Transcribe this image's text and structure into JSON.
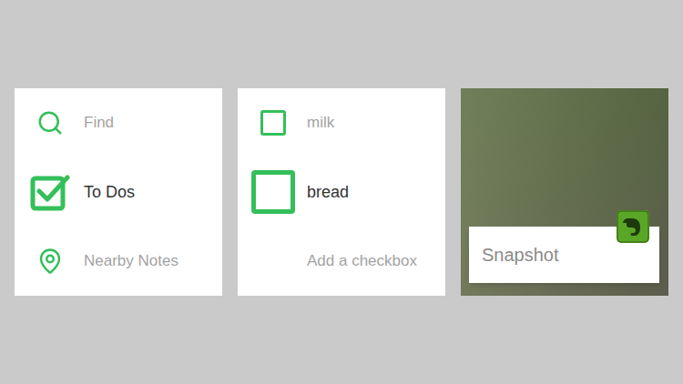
{
  "menu": {
    "items": [
      {
        "label": "Find",
        "kind": "search",
        "selected": false
      },
      {
        "label": "To Dos",
        "kind": "todo",
        "selected": true
      },
      {
        "label": "Nearby Notes",
        "kind": "pin",
        "selected": false
      }
    ]
  },
  "checklist": {
    "items": [
      {
        "label": "milk",
        "checked": false,
        "selected": false
      },
      {
        "label": "bread",
        "checked": false,
        "selected": true
      }
    ],
    "add_label": "Add a checkbox"
  },
  "snapshot": {
    "label": "Snapshot"
  }
}
